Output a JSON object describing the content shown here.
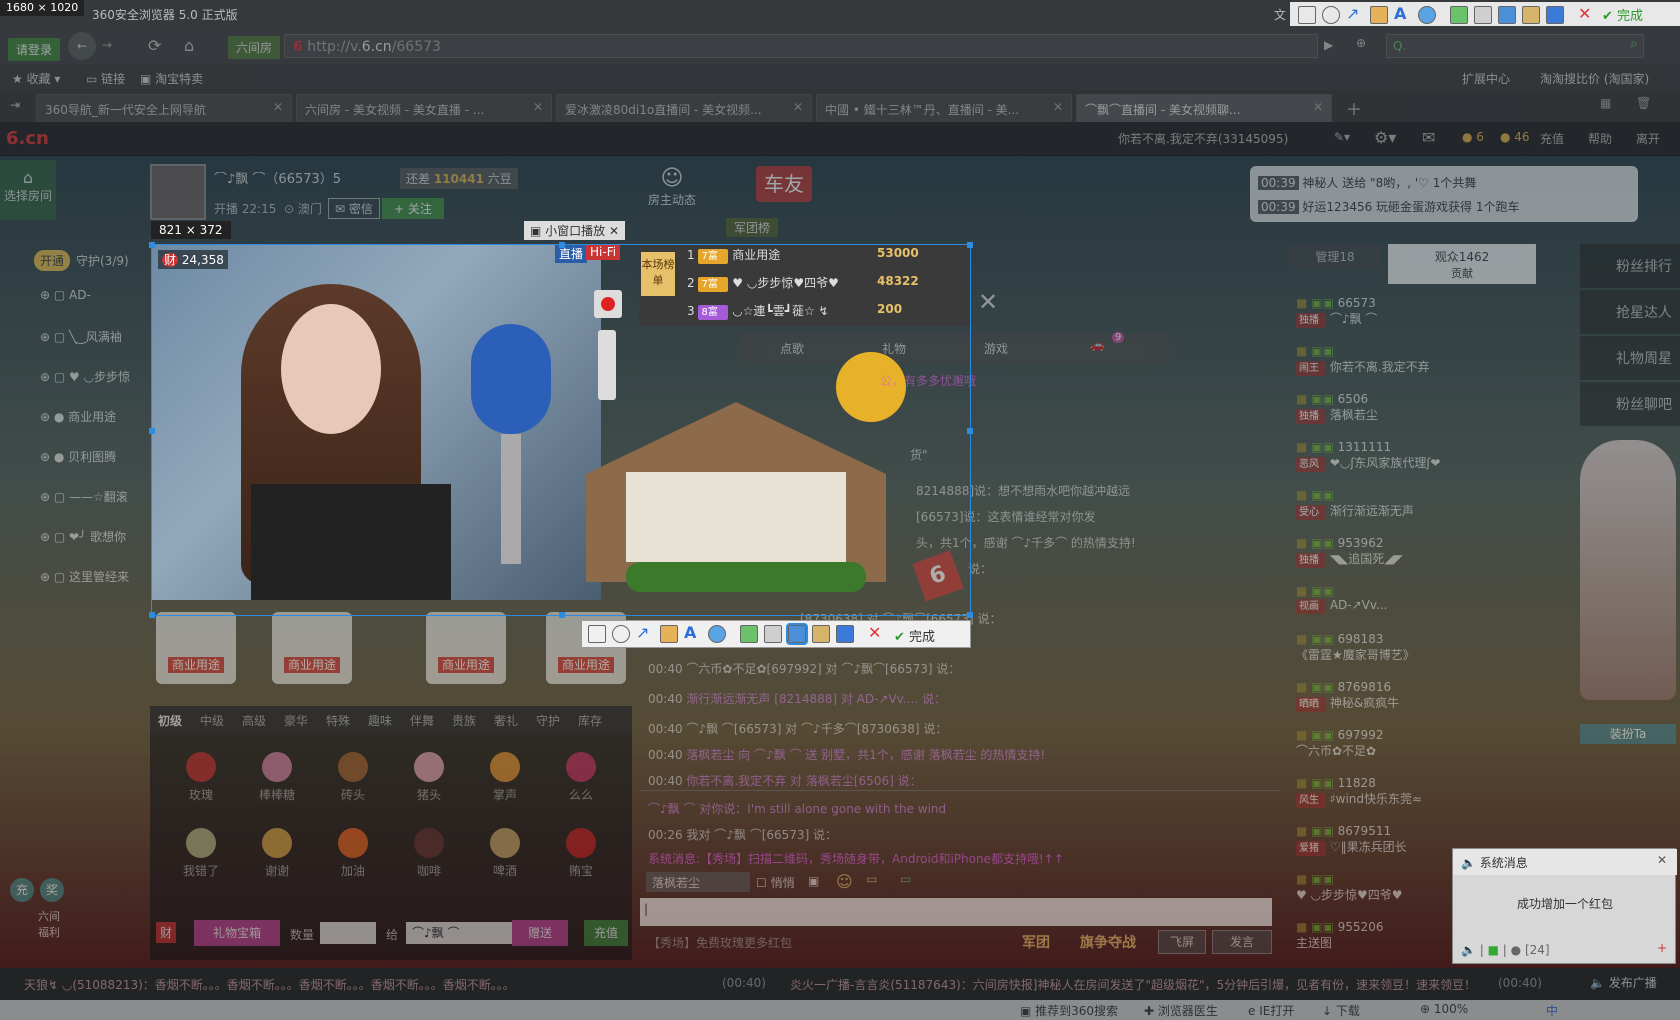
{
  "window": {
    "size_label": "1680 × 1020",
    "title": "360安全浏览器 5.0 正式版",
    "right_text": "文"
  },
  "toolbar": {
    "login": "请登录",
    "channel": "六间房",
    "url_prefix": "http://v.",
    "url_domain": "6.cn",
    "url_path": "/66573",
    "search_placeholder": "Q."
  },
  "favorites": {
    "items": [
      "收藏",
      "链接",
      "淘宝特卖"
    ],
    "right_items": [
      "扩展中心",
      "淘淘搜比价 (淘国家)"
    ]
  },
  "tabs": [
    {
      "label": "360导航_新一代安全上网导航",
      "active": false
    },
    {
      "label": "六间房 - 美女视频 - 美女直播 - ...",
      "active": false
    },
    {
      "label": "爱冰激凌80di1o直播间 - 美女视频...",
      "active": false
    },
    {
      "label": "中國 • 鐵十三林™丹、直播间 - 美...",
      "active": false
    },
    {
      "label": "⌒飘⌒直播间 - 美女视频聊...",
      "active": true
    }
  ],
  "site_header": {
    "logo": "6.cn",
    "user": "你若不离.我定不弃(33145095)",
    "coins": "6",
    "beans": "46",
    "recharge": "充值",
    "help": "帮助",
    "leave": "离开"
  },
  "host": {
    "name": "⌒♪飘 ⌒（66573）5",
    "still_need": "还差",
    "beans_needed": "110441",
    "beans_unit": "六豆",
    "live_time": "开播 22:15",
    "location": "澳门",
    "message_btn": "密信",
    "follow_btn": "+ 关注",
    "dynamics": "房主动态",
    "fans_group": "军团榜",
    "car_badge": "车友"
  },
  "left_panel": {
    "select_room": "选择房间",
    "open": "开通",
    "guard_label": "守护(3/9)",
    "guards": [
      "AD-",
      "╲‿风满袖",
      "♥ ◡步步惊",
      "商业用途",
      "贝利图腾",
      "——☆翻滚",
      "❤╯ 歌想你",
      "这里管经来"
    ]
  },
  "overlay": {
    "size": "821 × 372",
    "mini_window": "小窗口播放",
    "cai_badge": "财",
    "cai_value": "24,358",
    "live": "直播",
    "hifi": "Hi-Fi",
    "done": "完成"
  },
  "ranking": {
    "title": "本场榜单",
    "rows": [
      {
        "rank": "1",
        "name": "商业用途",
        "value": "53000"
      },
      {
        "rank": "2",
        "name": "♥ ◡步步惊♥四爷♥",
        "value": "48322"
      },
      {
        "rank": "3",
        "name": "◡☆連┗雲┛蓰☆ ↯",
        "value": "200"
      }
    ]
  },
  "func_tabs": [
    "点歌",
    "礼物",
    "游戏"
  ],
  "car_count": "9",
  "gift_stages": [
    "商业用途",
    "商业用途",
    "商业用途",
    "商业用途"
  ],
  "gift_tabs": [
    "初级",
    "中级",
    "高级",
    "豪华",
    "特殊",
    "趣味",
    "伴舞",
    "贵族",
    "奢礼",
    "守护",
    "库存"
  ],
  "gifts": [
    {
      "name": "玫瑰",
      "color": "#c33"
    },
    {
      "name": "棒棒糖",
      "color": "#d8a"
    },
    {
      "name": "砖头",
      "color": "#a63"
    },
    {
      "name": "猪头",
      "color": "#eab"
    },
    {
      "name": "掌声",
      "color": "#e93"
    },
    {
      "name": "么么",
      "color": "#c36"
    },
    {
      "name": "我错了",
      "color": "#bb8"
    },
    {
      "name": "谢谢",
      "color": "#da4"
    },
    {
      "name": "加油",
      "color": "#e62"
    },
    {
      "name": "咖啡",
      "color": "#633"
    },
    {
      "name": "啤酒",
      "color": "#ca6"
    },
    {
      "name": "贿宝",
      "color": "#c22"
    }
  ],
  "gift_bottom": {
    "treasure": "礼物宝箱",
    "qty_label": "数量",
    "to_label": "给",
    "to_value": "⌒♪飘 ⌒",
    "send": "赠送",
    "recharge": "充值",
    "cai": "财"
  },
  "left_icons": {
    "chong": "充",
    "jiang": "奖",
    "welfare": "六间福利"
  },
  "chat": {
    "tip_line": "公，有多多忧邂哦",
    "tip2": "货\"",
    "lines": [
      {
        "time": "",
        "text": "8214888]说：想不想雨水吧你越冲越远"
      },
      {
        "time": "",
        "text": "[66573]说：这表情谁经常对你发"
      },
      {
        "time": "",
        "text": "头，共1个，感谢 ⌒♪千多⌒ 的热情支持!"
      },
      {
        "time": "",
        "text": "说："
      },
      {
        "time": "",
        "text": "[8730638] 对 ⌒♪飘⌒[66573] 说："
      },
      {
        "time": "00:40",
        "text": "⌒六币✿不足✿[697992] 对 ⌒♪飘⌒[66573] 说："
      },
      {
        "time": "00:40",
        "text": "渐行渐远渐无声 [8214888] 对 AD-↗Vv.... 说："
      },
      {
        "time": "00:40",
        "text": "⌒♪飘 ⌒[66573] 对 ⌒♪千多⌒[8730638] 说："
      },
      {
        "time": "00:40",
        "text": "落枫若尘 向 ⌒♪飘 ⌒ 送 别墅，共1个，感谢 落枫若尘 的热情支持!"
      },
      {
        "time": "00:40",
        "text": "你若不离.我定不弃 对 落枫若尘[6506] 说："
      }
    ],
    "private_lines": [
      {
        "time": "",
        "text": "⌒♪飘 ⌒ 对你说：I'm still alone gone with the wind"
      },
      {
        "time": "00:26",
        "text": "我对 ⌒♪飘 ⌒[66573] 说："
      },
      {
        "time": "",
        "text": "系统消息:【秀场】扫描二维码，秀场随身带，Android和iPhone都支持哦!↑↑"
      }
    ],
    "input_target": "落枫若尘",
    "whisper": "悄悄",
    "input_value": "|",
    "promo": "【秀场】免费玫瑰更多红包",
    "fly": "飞屏",
    "send": "发言",
    "legion": "军团",
    "contest": "旗争夺战"
  },
  "user_tabs": {
    "admin": "管理18",
    "audience": "观众1462",
    "contribution": "贡献"
  },
  "users": [
    {
      "badge": "独播",
      "id": "66573",
      "name": "⌒♪飘 ⌒"
    },
    {
      "badge": "闹王",
      "id": "",
      "name": "你若不离.我定不弃"
    },
    {
      "badge": "独播",
      "id": "6506",
      "name": "落枫若尘"
    },
    {
      "badge": "恶风",
      "id": "1311111",
      "name": "❤◡ʃ东风家族代理ʃ❤"
    },
    {
      "badge": "受心",
      "id": "",
      "name": "渐行渐远渐无声"
    },
    {
      "badge": "独播",
      "id": "953962",
      "name": "◥◣追国死◢◤"
    },
    {
      "badge": "视画",
      "id": "",
      "name": "AD-↗Vv..."
    },
    {
      "badge": "",
      "id": "698183",
      "name": "《雷霆★魔家哥博艺》"
    },
    {
      "badge": "晒晒",
      "id": "8769816",
      "name": "神秘&疯疯牛"
    },
    {
      "badge": "",
      "id": "697992",
      "name": "⌒六币✿不足✿"
    },
    {
      "badge": "风生",
      "id": "11828",
      "name": "♯wind快乐东莞≈"
    },
    {
      "badge": "爱猪",
      "id": "8679511",
      "name": "♡‖果冻兵团长"
    },
    {
      "badge": "",
      "id": "",
      "name": "♥ ◡步步惊♥四爷♥"
    },
    {
      "badge": "",
      "id": "955206",
      "name": "主送图"
    }
  ],
  "right_side": {
    "items": [
      "粉丝排行",
      "抢星达人",
      "礼物周星",
      "粉丝聊吧"
    ],
    "dress": "装扮Ta"
  },
  "broadcast": [
    {
      "time": "00:39",
      "text": "神秘人 送给 \"8哟，, '♡ 1个共舞"
    },
    {
      "time": "00:39",
      "text": "好运123456 玩砸金蛋游戏获得 1个跑车"
    }
  ],
  "notice": {
    "title": "系统消息",
    "body": "成功增加一个红包",
    "count": "[24]"
  },
  "marquee": {
    "text1": "天狼↯ ◡(51088213)：香烟不断。。。香烟不断。。。香烟不断。。。香烟不断。。。香烟不断。。。",
    "time1": "(00:40)",
    "text2": "炎火一广播-言言炎(51187643)：六间房快报]神秘人在房间发送了\"超级烟花\"，5分钟后引爆，见者有份，速来领豆！速来领豆！",
    "time2": "(00:40)",
    "send": "发布广播"
  },
  "statusbar": {
    "items": [
      "推荐到360搜索",
      "浏览器医生",
      "IE打开",
      "下载",
      "100%"
    ],
    "lang": "中"
  }
}
